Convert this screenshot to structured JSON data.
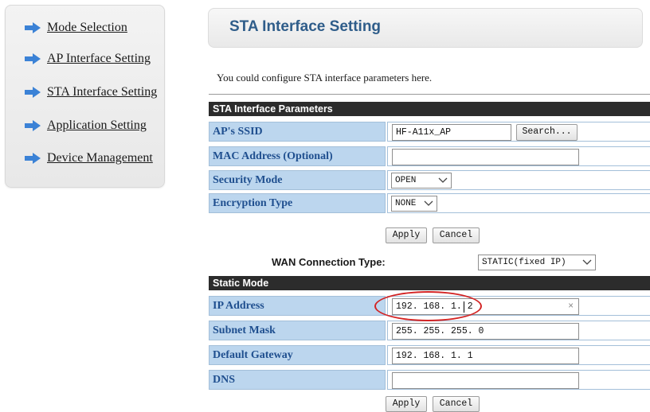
{
  "sidebar": {
    "items": [
      {
        "label": "Mode Selection",
        "icon": "arrow-right-icon"
      },
      {
        "label": "AP Interface Setting",
        "icon": "arrow-right-icon"
      },
      {
        "label": "STA Interface Setting",
        "icon": "arrow-right-icon"
      },
      {
        "label": "Application Setting",
        "icon": "arrow-right-icon"
      },
      {
        "label": "Device Management",
        "icon": "arrow-right-icon"
      }
    ]
  },
  "page": {
    "title": "STA Interface Setting",
    "intro": "You could configure STA interface parameters here."
  },
  "sta_params": {
    "header": "STA Interface Parameters",
    "ssid_label": "AP's SSID",
    "ssid_value": "HF-A11x_AP",
    "search_button": "Search...",
    "mac_label": "MAC Address (Optional)",
    "mac_value": "",
    "security_label": "Security Mode",
    "security_value": "OPEN",
    "encryption_label": "Encryption Type",
    "encryption_value": "NONE"
  },
  "sta_actions": {
    "apply": "Apply",
    "cancel": "Cancel"
  },
  "wan": {
    "label": "WAN Connection Type:",
    "value": "STATIC(fixed IP)"
  },
  "static_mode": {
    "header": "Static Mode",
    "ip_label": "IP Address",
    "ip_value": "192. 168. 1. 2",
    "ip_clear": "×",
    "subnet_label": "Subnet Mask",
    "subnet_value": "255. 255. 255. 0",
    "gateway_label": "Default Gateway",
    "gateway_value": "192. 168. 1. 1",
    "dns_label": "DNS",
    "dns_value": ""
  },
  "static_actions": {
    "apply": "Apply",
    "cancel": "Cancel"
  },
  "colors": {
    "accent_title": "#2f5d8a",
    "label_bg": "#bcd6ee",
    "label_text": "#1f4f8f",
    "header_bg": "#2c2c2c",
    "arrow_fill": "#3b82d6",
    "highlight": "#d32424"
  }
}
